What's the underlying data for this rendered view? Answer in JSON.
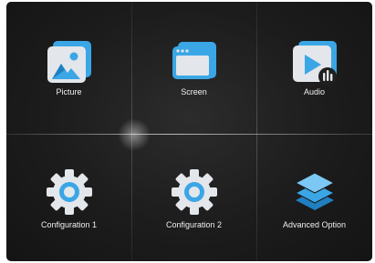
{
  "menu": {
    "items": [
      {
        "label": "Picture",
        "icon": "picture-icon"
      },
      {
        "label": "Screen",
        "icon": "screen-icon"
      },
      {
        "label": "Audio",
        "icon": "audio-icon"
      },
      {
        "label": "Configuration 1",
        "icon": "gear-icon"
      },
      {
        "label": "Configuration 2",
        "icon": "gear-icon"
      },
      {
        "label": "Advanced Option",
        "icon": "layers-icon"
      }
    ]
  },
  "colors": {
    "background": "#1e1e1e",
    "accent_blue": "#3aa6e6",
    "tile_light": "#d9dde2",
    "text": "#f0f0f0"
  }
}
